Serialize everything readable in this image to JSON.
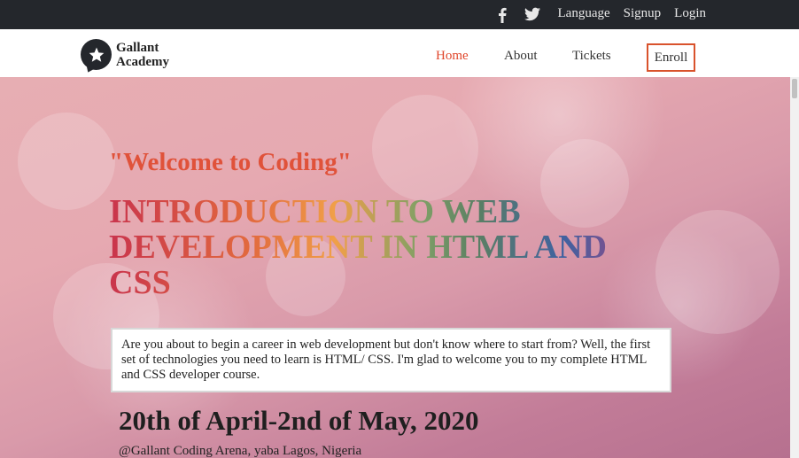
{
  "topbar": {
    "social_icons": [
      "facebook-icon",
      "twitter-icon"
    ],
    "links": [
      "Language",
      "Signup",
      "Login"
    ]
  },
  "brand": {
    "line1": "Gallant",
    "line2": "Academy",
    "icon": "star-chat-bubble-icon"
  },
  "nav": {
    "items": [
      "Home",
      "About",
      "Tickets"
    ],
    "active": "Home",
    "enroll_label": "Enroll"
  },
  "hero": {
    "welcome": "\"Welcome to Coding\"",
    "headline": "INTRODUCTION TO WEB DEVELOPMENT IN HTML AND CSS",
    "intro": "Are you about to begin a career in web development but don't know where to start from? Well, the first set of technologies you need to learn is HTML/ CSS. I'm glad to welcome you to my complete HTML and CSS developer course.",
    "date": "20th of April-2nd of May, 2020",
    "venue": "@Gallant Coding Arena, yaba Lagos, Nigeria"
  },
  "colors": {
    "topbar": "#24272c",
    "accent": "#e0452a",
    "enroll_border": "#d9532c"
  }
}
